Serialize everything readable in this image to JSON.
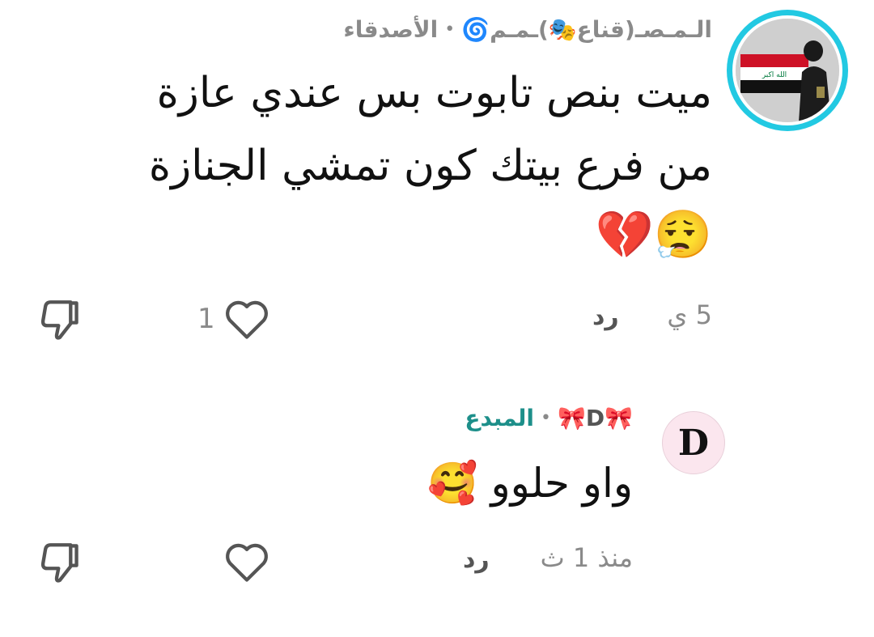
{
  "comments": [
    {
      "author": "الـمـصـ(قناع🎭)ـمـم🌀",
      "separator": "•",
      "badge": "الأصدقاء",
      "lines": [
        "ميت بنص تابوت بس عندي عازة",
        "من فرع بيتك كون تمشي الجنازة",
        "😮‍💨💔"
      ],
      "time": "5 ي",
      "reply_label": "رد",
      "like_count": "1"
    },
    {
      "author": "🎀D🎀",
      "separator": "•",
      "badge": "المبدع",
      "avatar_letter": "D",
      "lines": [
        "واو حلوو 🥰"
      ],
      "time": "منذ 1 ث",
      "reply_label": "رد",
      "like_count": ""
    }
  ],
  "colors": {
    "avatar_ring": "#22c9e2",
    "creator_badge": "#1d8f8a",
    "muted_text": "#8a8a8a"
  },
  "icons": [
    "heart-icon",
    "thumbs-down-icon"
  ]
}
